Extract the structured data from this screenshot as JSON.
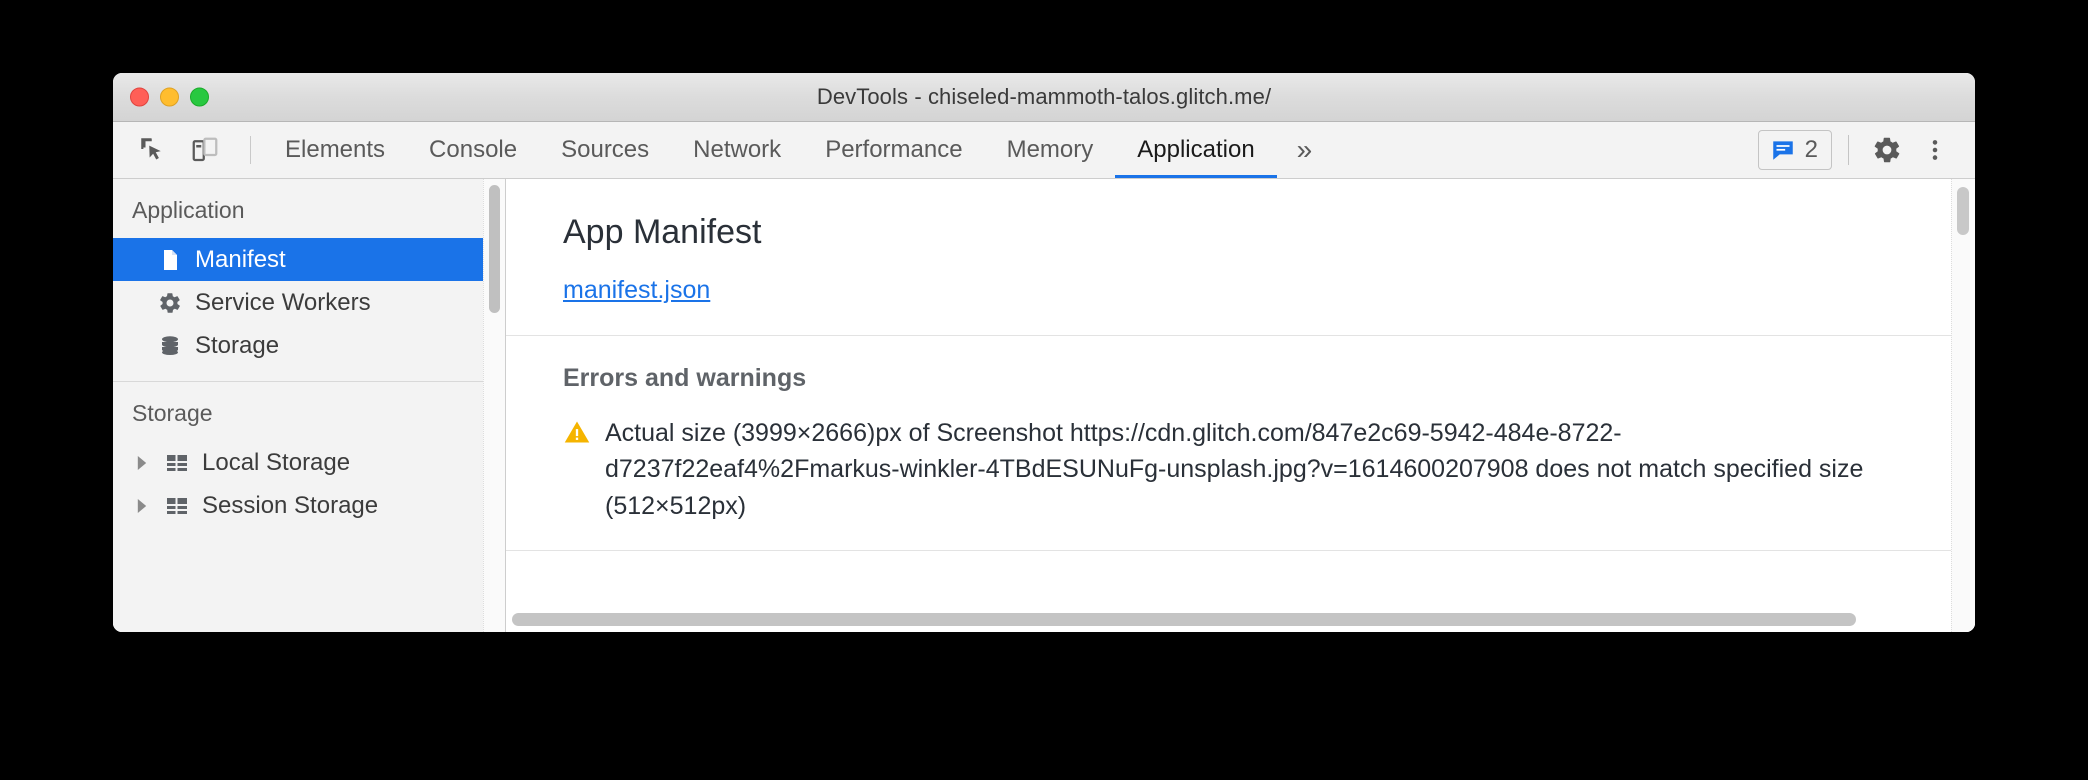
{
  "window": {
    "title": "DevTools - chiseled-mammoth-talos.glitch.me/",
    "traffic_lights": [
      "close",
      "minimize",
      "zoom"
    ],
    "colors": {
      "accent": "#1a73e8",
      "warning": "#f5b400",
      "close": "#ff5f57",
      "minimize": "#ffbd2e",
      "zoom": "#28c840"
    }
  },
  "toolbar": {
    "inspect_icon": "inspect-cursor-icon",
    "device_icon": "device-toolbar-icon",
    "tabs": [
      {
        "label": "Elements",
        "active": false
      },
      {
        "label": "Console",
        "active": false
      },
      {
        "label": "Sources",
        "active": false
      },
      {
        "label": "Network",
        "active": false
      },
      {
        "label": "Performance",
        "active": false
      },
      {
        "label": "Memory",
        "active": false
      },
      {
        "label": "Application",
        "active": true
      }
    ],
    "more_tabs_label": "»",
    "issues": {
      "icon": "issues-message-icon",
      "count": "2"
    },
    "settings_icon": "gear-icon",
    "more_options_icon": "kebab-menu-icon"
  },
  "sidebar": {
    "groups": [
      {
        "title": "Application",
        "items": [
          {
            "label": "Manifest",
            "icon": "document-icon",
            "selected": true,
            "expandable": false
          },
          {
            "label": "Service Workers",
            "icon": "gear-icon",
            "selected": false,
            "expandable": false
          },
          {
            "label": "Storage",
            "icon": "database-icon",
            "selected": false,
            "expandable": false
          }
        ]
      },
      {
        "title": "Storage",
        "items": [
          {
            "label": "Local Storage",
            "icon": "table-icon",
            "selected": false,
            "expandable": true
          },
          {
            "label": "Session Storage",
            "icon": "table-icon",
            "selected": false,
            "expandable": true
          }
        ]
      }
    ]
  },
  "main": {
    "heading": "App Manifest",
    "manifest_link": "manifest.json",
    "errors_section": {
      "title": "Errors and warnings",
      "items": [
        {
          "severity": "warning",
          "icon": "warning-triangle-icon",
          "text": "Actual size (3999×2666)px of Screenshot https://cdn.glitch.com/847e2c69-5942-484e-8722-d7237f22eaf4%2Fmarkus-winkler-4TBdESUNuFg-unsplash.jpg?v=1614600207908 does not match specified size (512×512px)"
        }
      ]
    }
  }
}
